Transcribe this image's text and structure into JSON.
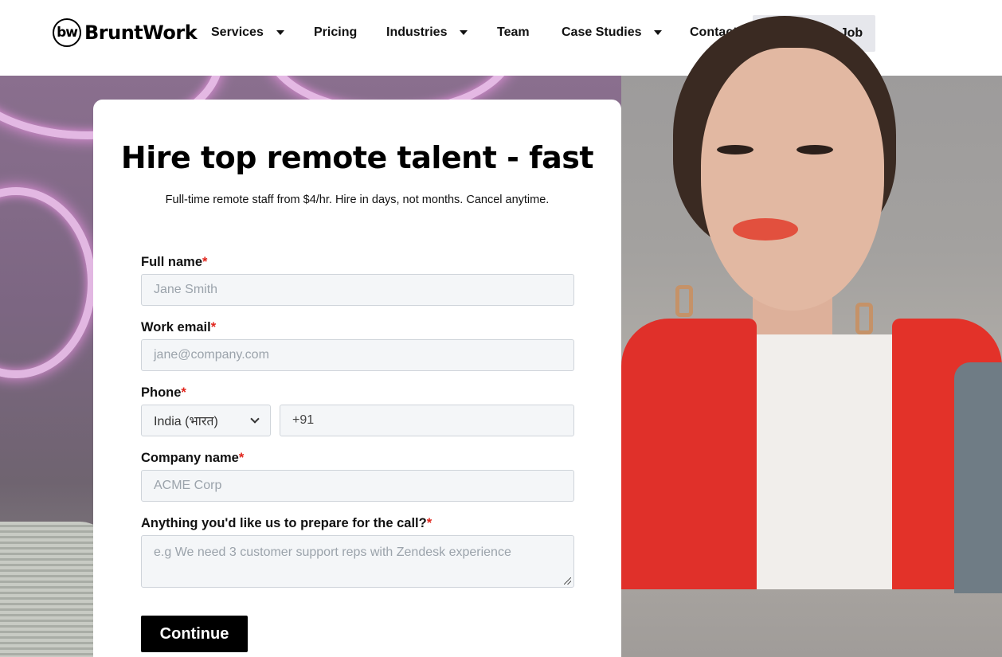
{
  "nav": {
    "logo_mark": "bw",
    "logo_text": "BruntWork",
    "items": [
      {
        "label": "Services",
        "has_dropdown": true
      },
      {
        "label": "Pricing",
        "has_dropdown": false
      },
      {
        "label": "Industries",
        "has_dropdown": true
      },
      {
        "label": "Team",
        "has_dropdown": false
      },
      {
        "label": "Case Studies",
        "has_dropdown": true
      },
      {
        "label": "Contact",
        "has_dropdown": false
      }
    ],
    "cta": "Apply For A Job"
  },
  "form": {
    "title": "Hire top remote talent - fast",
    "subtitle": "Full-time remote staff from $4/hr. Hire in days, not months. Cancel anytime.",
    "required_mark": "*",
    "full_name": {
      "label": "Full name",
      "placeholder": "Jane Smith"
    },
    "work_email": {
      "label": "Work email",
      "placeholder": "jane@company.com"
    },
    "phone": {
      "label": "Phone",
      "country": "India (भारत)",
      "value": "+91"
    },
    "company": {
      "label": "Company name",
      "placeholder": "ACME Corp"
    },
    "notes": {
      "label": "Anything you'd like us to prepare for the call?",
      "placeholder": "e.g We need 3 customer support reps with Zendesk experience"
    },
    "submit": "Continue"
  },
  "colors": {
    "required": "#e0241b",
    "button_bg": "#000000",
    "field_bg": "#f4f6f8",
    "cta_bg": "#e6e7ec",
    "jacket": "#e0302a"
  }
}
